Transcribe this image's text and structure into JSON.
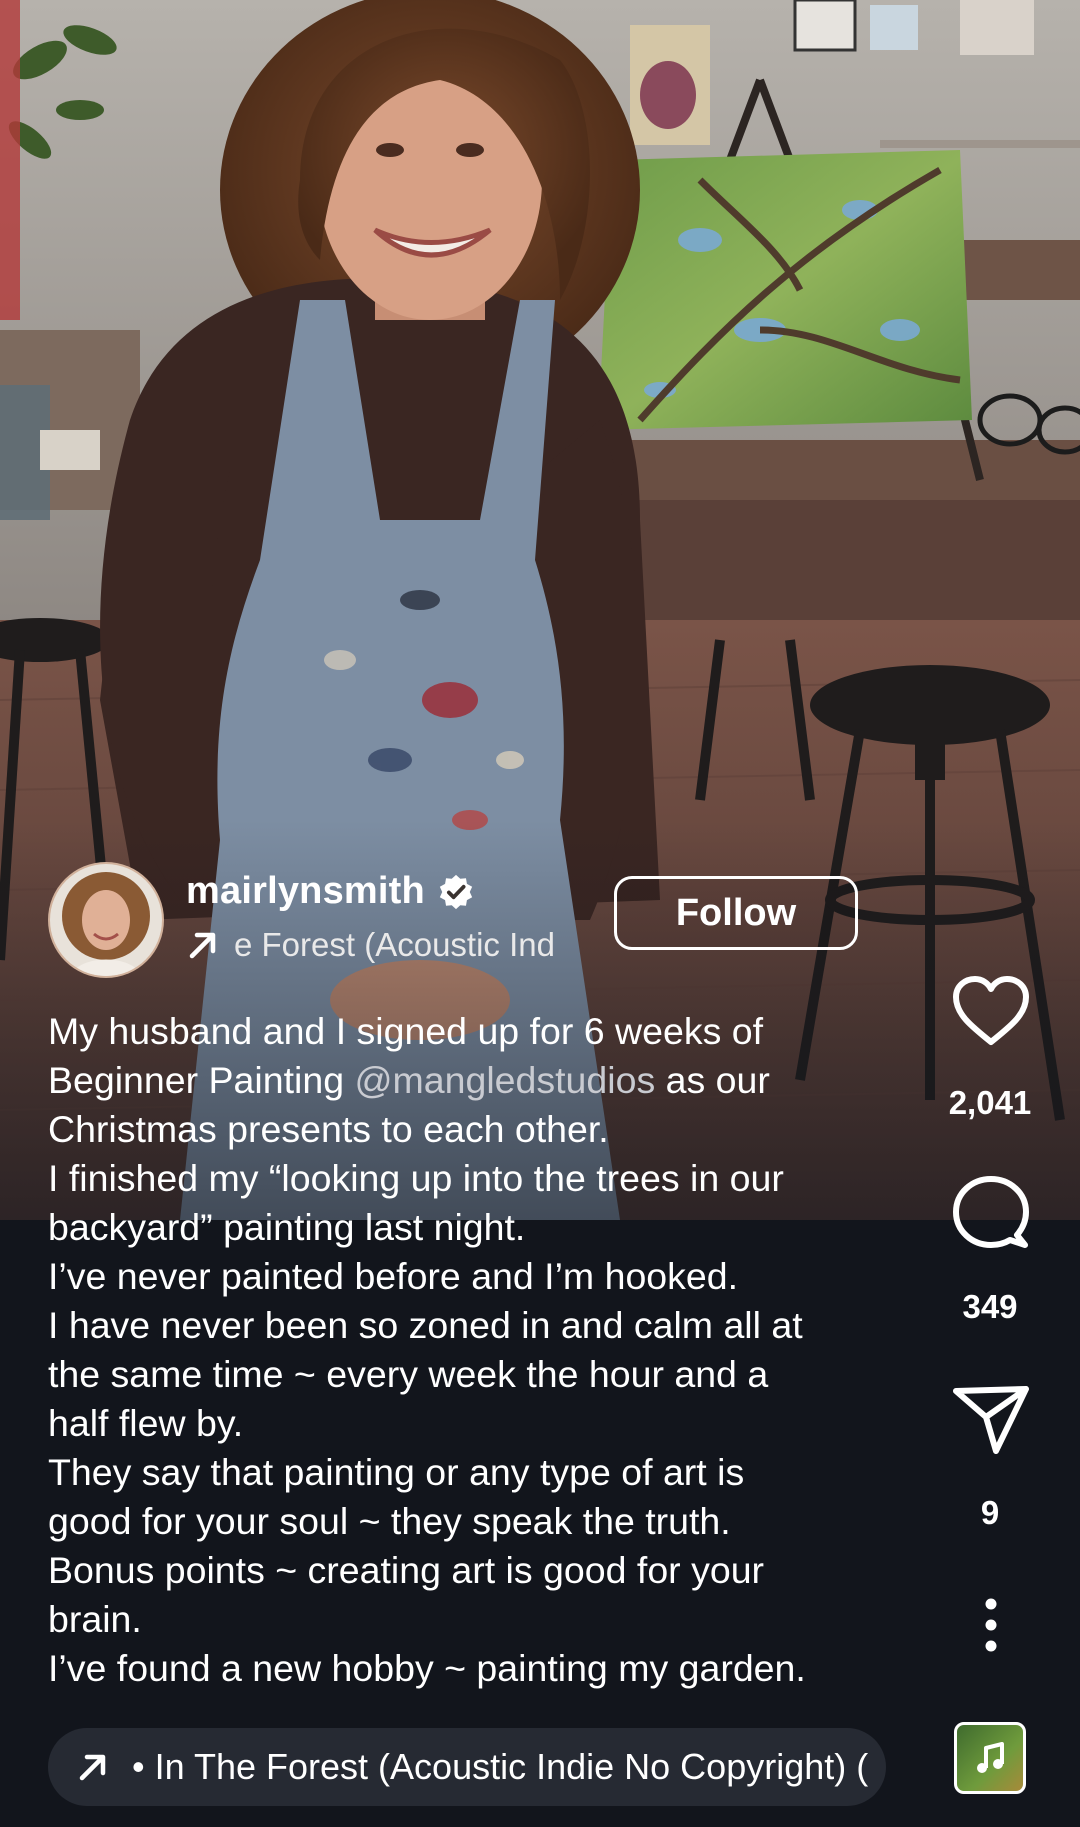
{
  "post": {
    "username": "mairlynsmith",
    "audio_marquee": "e Forest (Acoustic Ind",
    "follow_label": "Follow"
  },
  "caption": {
    "lines": [
      {
        "parts": [
          {
            "text": "My husband and I signed up for 6 weeks of",
            "mention": false
          }
        ]
      },
      {
        "parts": [
          {
            "text": "Beginner Painting ",
            "mention": false
          },
          {
            "text": "@mangledstudios",
            "mention": true
          },
          {
            "text": " as our",
            "mention": false
          }
        ]
      },
      {
        "parts": [
          {
            "text": "Christmas presents to each other.",
            "mention": false
          }
        ]
      },
      {
        "parts": [
          {
            "text": "I finished my “looking up into the trees in our",
            "mention": false
          }
        ]
      },
      {
        "parts": [
          {
            "text": "backyard” painting last night.",
            "mention": false
          }
        ]
      },
      {
        "parts": [
          {
            "text": "I’ve never painted before and I’m hooked.",
            "mention": false
          }
        ]
      },
      {
        "parts": [
          {
            "text": "I have never been so zoned in and calm all at",
            "mention": false
          }
        ]
      },
      {
        "parts": [
          {
            "text": "the same time ~ every week the hour and a",
            "mention": false
          }
        ]
      },
      {
        "parts": [
          {
            "text": "half flew by.",
            "mention": false
          }
        ]
      },
      {
        "parts": [
          {
            "text": "They say that painting or any type of art is",
            "mention": false
          }
        ]
      },
      {
        "parts": [
          {
            "text": "good for your soul ~ they speak the truth.",
            "mention": false
          }
        ]
      },
      {
        "parts": [
          {
            "text": "Bonus points ~ creating art is good for your",
            "mention": false
          }
        ]
      },
      {
        "parts": [
          {
            "text": "brain.",
            "mention": false
          }
        ]
      },
      {
        "parts": [
          {
            "text": "I’ve found a new hobby ~ painting my garden.",
            "mention": false
          }
        ]
      }
    ]
  },
  "actions": {
    "likes": "2,041",
    "comments": "349",
    "shares": "9"
  },
  "audio": {
    "track": "• In The Forest (Acoustic Indie No Copyright) ("
  },
  "icons": {
    "verified": "verified-badge-icon",
    "audio_arrow": "arrow-up-right-icon",
    "like": "heart-icon",
    "comment": "comment-bubble-icon",
    "share": "paper-plane-icon",
    "more": "more-vertical-icon",
    "music": "music-note-icon"
  },
  "colors": {
    "background": "#12151c",
    "pill": "#262a33",
    "text": "#ffffff",
    "mention": "#c9cbd1"
  }
}
